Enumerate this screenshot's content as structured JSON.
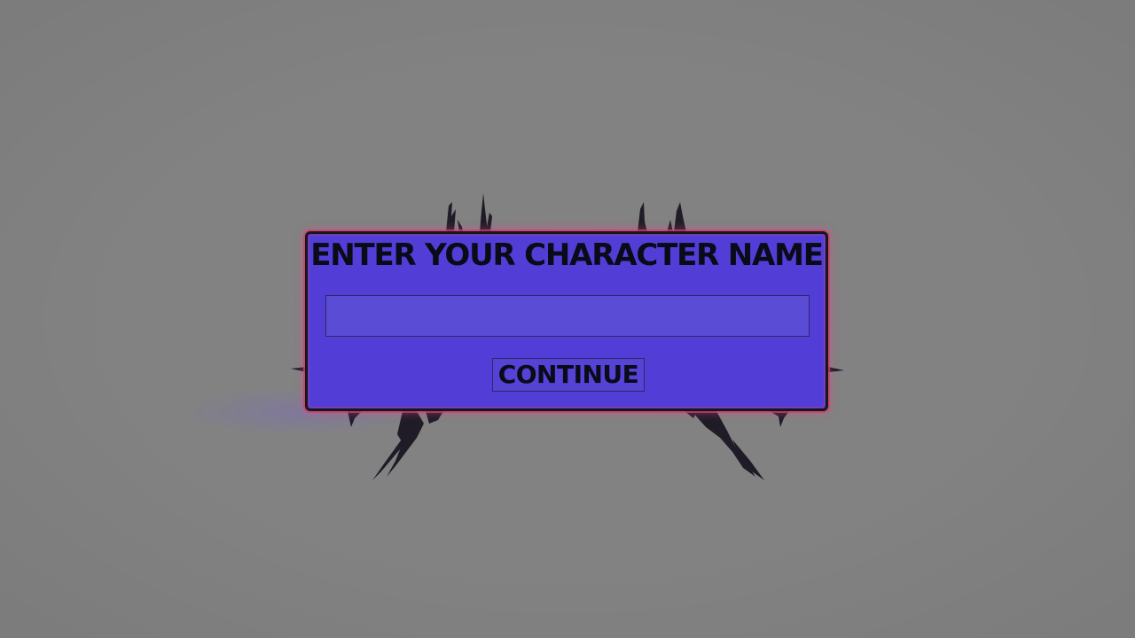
{
  "dialog": {
    "title": "ENTER YOUR CHARACTER NAME",
    "name_input": {
      "value": "",
      "placeholder": ""
    },
    "continue_label": "CONTINUE"
  },
  "colors": {
    "background": "#808080",
    "panel": "#523ed6",
    "panel_border": "#171717",
    "glow": "#e0478e",
    "text": "#0a0a18",
    "splatter": "#15121e"
  }
}
